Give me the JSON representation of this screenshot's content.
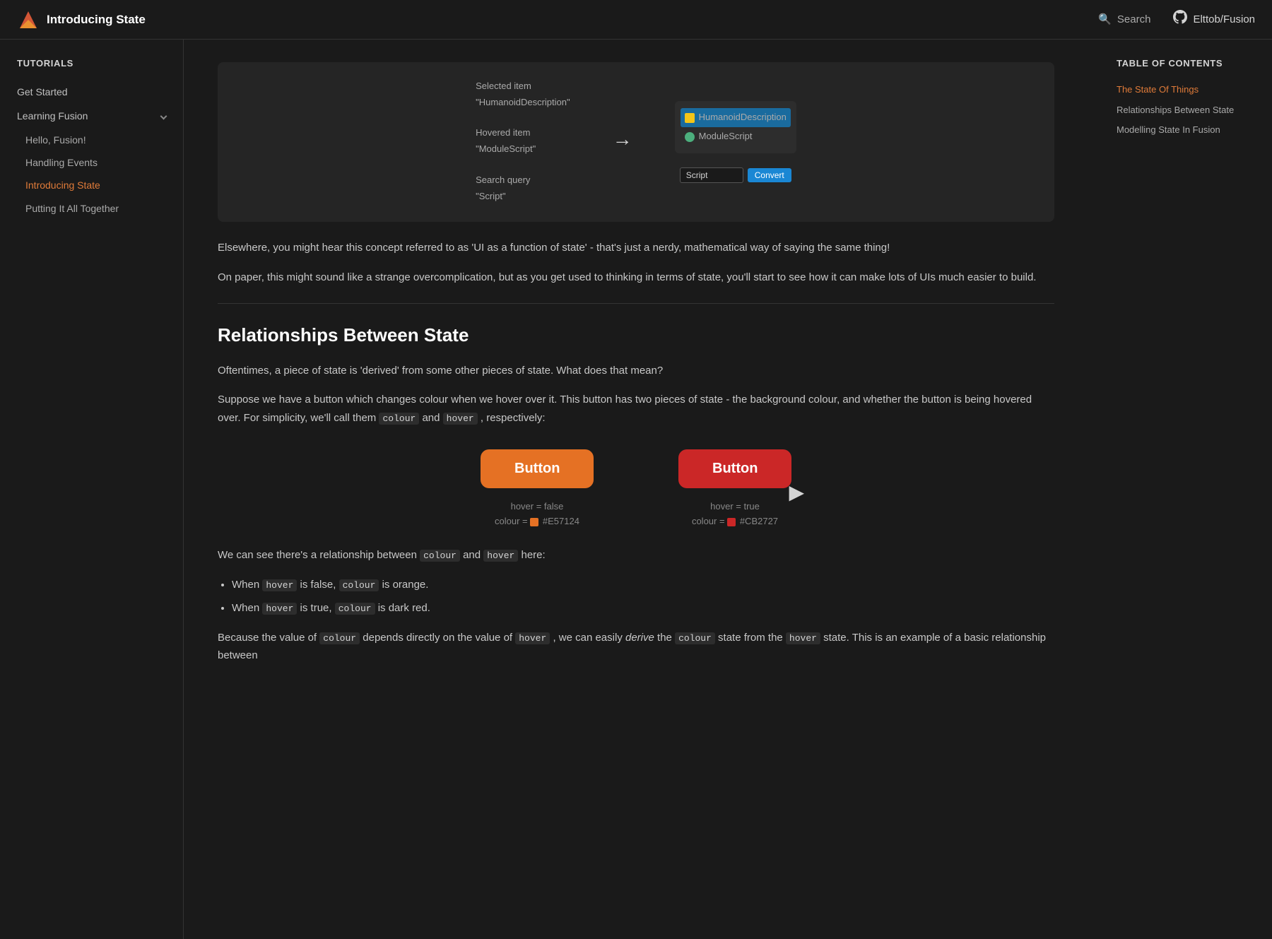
{
  "header": {
    "title": "Introducing State",
    "search_label": "Search",
    "github_label": "Elttob/Fusion"
  },
  "sidebar": {
    "tutorials_label": "Tutorials",
    "get_started": "Get Started",
    "learning_fusion": {
      "label": "Learning Fusion",
      "children": [
        {
          "label": "Hello, Fusion!",
          "active": false
        },
        {
          "label": "Handling Events",
          "active": false
        },
        {
          "label": "Introducing State",
          "active": true
        },
        {
          "label": "Putting It All Together",
          "active": false
        }
      ]
    }
  },
  "toc": {
    "title": "Table of contents",
    "items": [
      {
        "label": "The State Of Things",
        "active": true
      },
      {
        "label": "Relationships Between State",
        "active": false
      },
      {
        "label": "Modelling State In Fusion",
        "active": false
      }
    ]
  },
  "demo": {
    "selected_label": "Selected item",
    "selected_value": "\"HumanoidDescription\"",
    "hovered_label": "Hovered item",
    "hovered_value": "\"ModuleScript\"",
    "search_label": "Search query",
    "search_value": "\"Script\"",
    "explorer_humanoid": "HumanoidDescription",
    "explorer_module": "ModuleScript",
    "search_input_placeholder": "Script",
    "convert_btn": "Convert"
  },
  "content": {
    "elsewhere_text": "Elsewhere, you might hear this concept referred to as 'UI as a function of state' - that's just a nerdy, mathematical way of saying the same thing!",
    "onpaper_text": "On paper, this might sound like a strange overcomplication, but as you get used to thinking in terms of state, you'll start to see how it can make lots of UIs much easier to build.",
    "relationships_heading": "Relationships Between State",
    "oftentimes_text": "Oftentimes, a piece of state is 'derived' from some other pieces of state. What does that mean?",
    "suppose_text": "Suppose we have a button which changes colour when we hover over it. This button has two pieces of state - the background colour, and whether the button is being hovered over. For simplicity, we'll call them",
    "suppose_code1": "colour",
    "suppose_and": "and",
    "suppose_code2": "hover",
    "suppose_end": ", respectively:",
    "btn_label": "Button",
    "hover_false_label": "hover = false",
    "hover_false_colour_label": "colour =",
    "hover_false_colour_hex": "#E57124",
    "hover_true_label": "hover = true",
    "hover_true_colour_label": "colour =",
    "hover_true_colour_hex": "#CB2727",
    "we_can_see": "We can see there's a relationship between",
    "we_can_code1": "colour",
    "we_can_and": "and",
    "we_can_code2": "hover",
    "we_can_end": "here:",
    "when_hover_false_prefix": "When",
    "when_hover_false_code": "hover",
    "when_hover_false_mid": "is false,",
    "when_hover_false_code2": "colour",
    "when_hover_false_end": "is orange.",
    "when_hover_true_prefix": "When",
    "when_hover_true_code": "hover",
    "when_hover_true_mid": "is true,",
    "when_hover_true_code2": "colour",
    "when_hover_true_end": "is dark red.",
    "because_text": "Because the value of",
    "because_code1": "colour",
    "because_mid": "depends directly on the value of",
    "because_code2": "hover",
    "because_end": ", we can easily",
    "derive_word": "derive",
    "derive_end": "the",
    "derive_code": "colour",
    "derive_tail": "state from the",
    "derive_code2": "hover",
    "derive_tail2": "state. This is an example of a basic relationship between"
  }
}
